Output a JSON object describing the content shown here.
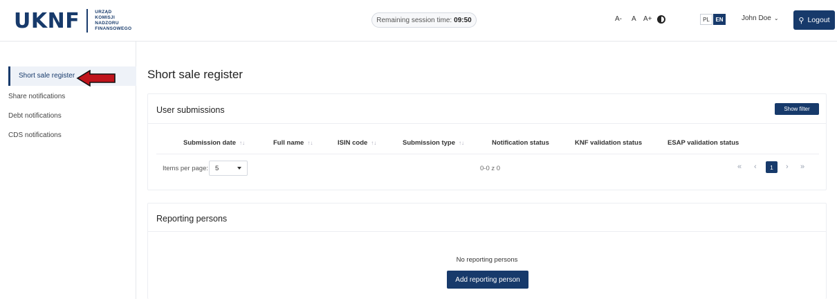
{
  "header": {
    "logo_main": "UKNF",
    "logo_lines": [
      "URZĄD",
      "KOMISJI",
      "NADZORU",
      "FINANSOWEGO"
    ],
    "session_label": "Remaining session time:",
    "session_time": "09:50",
    "font_decrease": "A-",
    "font_normal": "A",
    "font_increase": "A+",
    "lang_pl": "PL",
    "lang_en": "EN",
    "user_name": "John Doe",
    "logout_label": "Logout"
  },
  "sidebar": {
    "items": [
      {
        "label": "Short sale register",
        "active": true
      },
      {
        "label": "Share notifications"
      },
      {
        "label": "Debt notifications"
      },
      {
        "label": "CDS notifications"
      }
    ]
  },
  "main": {
    "page_title": "Short sale register",
    "submissions": {
      "title": "User submissions",
      "show_filter": "Show filter",
      "columns": [
        {
          "label": "Submission date",
          "sortable": true
        },
        {
          "label": "Full name",
          "sortable": true
        },
        {
          "label": "ISIN code",
          "sortable": true
        },
        {
          "label": "Submission type",
          "sortable": true
        },
        {
          "label": "Notification status",
          "sortable": false
        },
        {
          "label": "KNF validation status",
          "sortable": false
        },
        {
          "label": "ESAP validation status",
          "sortable": false
        }
      ],
      "items_per_page_label": "Items per page:",
      "items_per_page_value": "5",
      "range_text": "0-0 z 0",
      "current_page": "1"
    },
    "reporting": {
      "title": "Reporting persons",
      "empty_text": "No reporting persons",
      "add_button": "Add reporting person"
    }
  },
  "colors": {
    "brand": "#173a6b",
    "annotation_arrow": "#c0141c"
  },
  "icons": {
    "sort": "sort-icon",
    "contrast": "contrast-icon",
    "logout": "logout-icon",
    "user_dropdown": "chevron-down-icon",
    "pagination": [
      "first-page-icon",
      "prev-page-icon",
      "next-page-icon",
      "last-page-icon"
    ]
  }
}
